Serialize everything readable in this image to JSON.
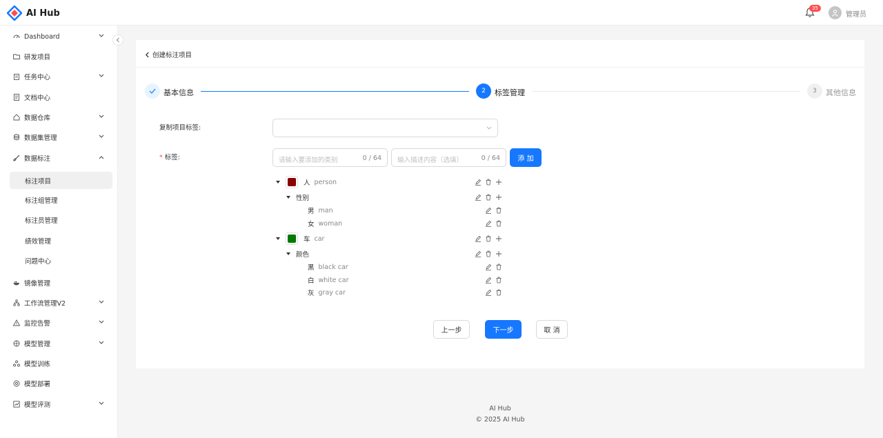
{
  "app": {
    "name": "AI Hub"
  },
  "header": {
    "notification_count": "35",
    "user_name": "管理员"
  },
  "sidebar": {
    "items": [
      {
        "label": "Dashboard",
        "icon": "dashboard-icon",
        "expandable": true,
        "expanded": false
      },
      {
        "label": "研发项目",
        "icon": "folder-icon",
        "expandable": false
      },
      {
        "label": "任务中心",
        "icon": "clipboard-icon",
        "expandable": true,
        "expanded": false
      },
      {
        "label": "文档中心",
        "icon": "document-icon",
        "expandable": false
      },
      {
        "label": "数据仓库",
        "icon": "home-icon",
        "expandable": true,
        "expanded": false
      },
      {
        "label": "数据集管理",
        "icon": "database-icon",
        "expandable": true,
        "expanded": false
      },
      {
        "label": "数据标注",
        "icon": "brush-icon",
        "expandable": true,
        "expanded": true
      },
      {
        "label": "标注项目",
        "sub": true,
        "active": true
      },
      {
        "label": "标注组管理",
        "sub": true
      },
      {
        "label": "标注员管理",
        "sub": true
      },
      {
        "label": "绩效管理",
        "sub": true
      },
      {
        "label": "问题中心",
        "sub": true
      },
      {
        "label": "镜像管理",
        "icon": "docker-icon",
        "expandable": false
      },
      {
        "label": "工作流管理V2",
        "icon": "workflow-icon",
        "expandable": true,
        "expanded": false
      },
      {
        "label": "监控告警",
        "icon": "warning-icon",
        "expandable": true,
        "expanded": false
      },
      {
        "label": "模型管理",
        "icon": "model-icon",
        "expandable": true,
        "expanded": false
      },
      {
        "label": "模型训练",
        "icon": "training-icon",
        "expandable": false
      },
      {
        "label": "模型部署",
        "icon": "deploy-icon",
        "expandable": false
      },
      {
        "label": "模型评测",
        "icon": "evaluation-icon",
        "expandable": true,
        "expanded": false
      }
    ]
  },
  "page": {
    "back_label": "创建标注项目"
  },
  "steps": [
    {
      "number": "1",
      "title": "基本信息",
      "status": "finished"
    },
    {
      "number": "2",
      "title": "标签管理",
      "status": "current"
    },
    {
      "number": "3",
      "title": "其他信息",
      "status": "waiting"
    }
  ],
  "form": {
    "copy_label": "复制项目标签:",
    "tags_label": "标签:",
    "category_placeholder": "请输入要添加的类别",
    "category_count": "0 / 64",
    "desc_placeholder": "输入描述内容（选填）",
    "desc_count": "0 / 64",
    "add_button": "添 加"
  },
  "tree": {
    "person": {
      "cn": "人",
      "en": "person",
      "color": "#8b0000"
    },
    "gender": {
      "cn": "性别"
    },
    "man": {
      "cn": "男",
      "en": "man"
    },
    "woman": {
      "cn": "女",
      "en": "woman"
    },
    "car": {
      "cn": "车",
      "en": "car",
      "color": "#007a00"
    },
    "color_attr": {
      "cn": "颜色"
    },
    "black": {
      "cn": "黑",
      "en": "black car"
    },
    "white": {
      "cn": "白",
      "en": "white car"
    },
    "gray": {
      "cn": "灰",
      "en": "gray car"
    }
  },
  "buttons": {
    "prev": "上一步",
    "next": "下一步",
    "cancel": "取 消"
  },
  "footer": {
    "line1": "AI Hub",
    "line2": "© 2025 AI Hub"
  },
  "colors": {
    "primary": "#1677ff",
    "danger": "#ff4d4f"
  }
}
